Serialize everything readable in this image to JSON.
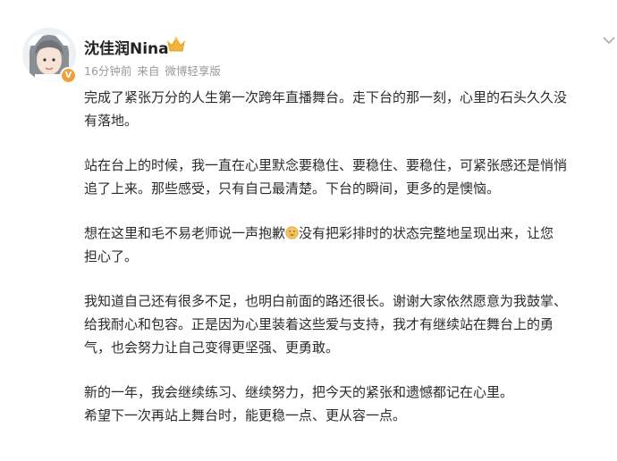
{
  "author": {
    "name": "沈佳润Nina",
    "badge_icon": "crown-icon",
    "verified_icon": "v-badge-icon"
  },
  "meta": {
    "time": "16分钟前",
    "source_prefix": "来自",
    "source": "微博轻享版"
  },
  "body": {
    "p1": {
      "l1": "完成了紧张万分的人生第一次跨年直播舞台。走下台的那一刻，心里的石头久久没",
      "l2": "有落地。"
    },
    "p2": {
      "l1": "站在台上的时候，我一直在心里默念要稳住、要稳住、要稳住，可紧张感还是悄悄",
      "l2": "追了上来。那些感受，只有自己最清楚。下台的瞬间，更多的是懊恼。"
    },
    "p3": {
      "l1a": "想在这里和毛不易老师说一声抱歉",
      "l1b": "没有把彩排时的状态完整地呈现出来，让您",
      "l2": "担心了。",
      "emoji_icon": "apologetic-face-icon"
    },
    "p4": {
      "l1": "我知道自己还有很多不足，也明白前面的路还很长。谢谢大家依然愿意为我鼓掌、",
      "l2": "给我耐心和包容。正是因为心里装着这些爱与支持，我才有继续站在舞台上的勇",
      "l3": "气，也会努力让自己变得更坚强、更勇敢。"
    },
    "p5": {
      "l1": "新的一年，我会继续练习、继续努力，把今天的紧张和遗憾都记在心里。",
      "l2": "希望下一次再站上舞台时，能更稳一点、更从容一点。"
    }
  },
  "colors": {
    "name": "#222222",
    "meta": "#9a9a9a",
    "body": "#2b2b2b",
    "badge": "#f0a23a"
  }
}
